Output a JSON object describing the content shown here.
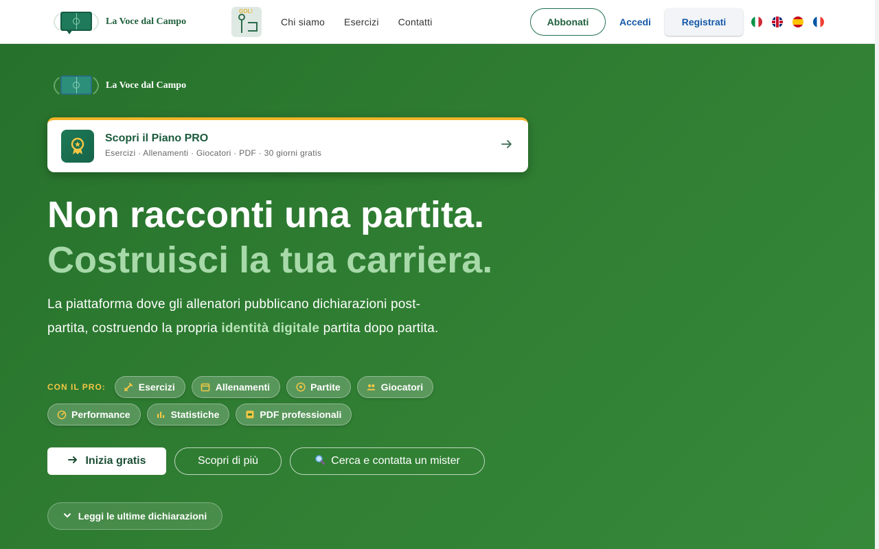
{
  "brand": {
    "name": "La Voce dal Campo"
  },
  "header": {
    "logo_icon": "speech-bubble-pitch-icon",
    "gol_icon": "gol-goal-icon",
    "gol_text": "GOL!",
    "nav": [
      "Chi siamo",
      "Esercizi",
      "Contatti"
    ],
    "abbonati_label": "Abbonati",
    "accedi_label": "Accedi",
    "registrati_label": "Registrati",
    "languages": [
      "it",
      "gb",
      "es",
      "fr"
    ]
  },
  "hero": {
    "promo": {
      "icon": "award-badge-icon",
      "title": "Scopri il Piano PRO",
      "subtitle": "Esercizi · Allenamenti · Giocatori · PDF · 30 giorni gratis",
      "arrow_icon": "arrow-right-icon"
    },
    "headline_line1": "Non racconti una partita.",
    "headline_line2": "Costruisci la tua carriera.",
    "lead_before": "La piattaforma dove gli allenatori pubblicano dichiarazioni post-partita, costruendo la propria ",
    "lead_highlight": "identità digitale",
    "lead_after": " partita dopo partita.",
    "pro_label": "CON IL PRO:",
    "chips": [
      {
        "label": "Esercizi",
        "icon": "pencil-ruler-icon"
      },
      {
        "label": "Allenamenti",
        "icon": "calendar-icon"
      },
      {
        "label": "Partite",
        "icon": "soccer-ball-icon"
      },
      {
        "label": "Giocatori",
        "icon": "users-icon"
      },
      {
        "label": "Performance",
        "icon": "speedometer-icon"
      },
      {
        "label": "Statistiche",
        "icon": "bar-chart-icon"
      },
      {
        "label": "PDF professionali",
        "icon": "pdf-file-icon"
      }
    ],
    "cta_start": "Inizia gratis",
    "cta_more": "Scopri di più",
    "cta_search": "Cerca e contatta un mister",
    "read_latest": "Leggi le ultime dichiarazioni"
  },
  "colors": {
    "brand_green": "#2f7d32",
    "accent_yellow": "#f0b428",
    "link_blue": "#1659a8"
  }
}
